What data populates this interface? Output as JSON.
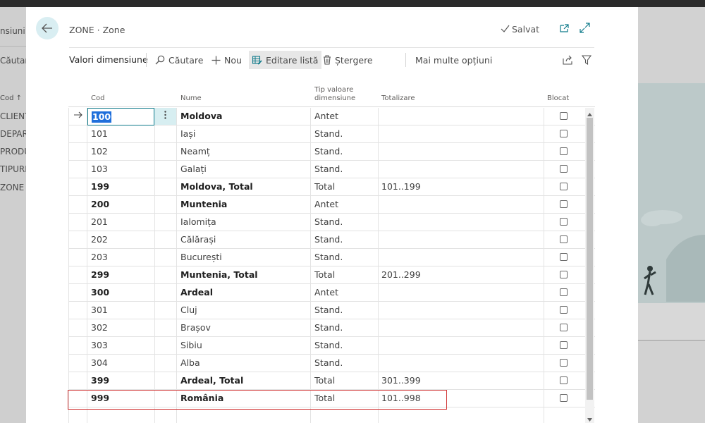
{
  "background": {
    "left_items": [
      "nsiuni",
      "Căutare",
      "Cod ↑",
      "CLIENT",
      "DEPAR",
      "PRODU",
      "TIPURI",
      "ZONE"
    ]
  },
  "header": {
    "breadcrumb": "ZONE · Zone",
    "saved_label": "Salvat"
  },
  "toolbar": {
    "title": "Valori dimensiune",
    "search_label": "Căutare",
    "new_label": "Nou",
    "edit_list_label": "Editare listă",
    "delete_label": "Ștergere",
    "more_label": "Mai multe opțiuni"
  },
  "table": {
    "columns": {
      "code": "Cod",
      "name": "Nume",
      "type_line1": "Tip valoare",
      "type_line2": "dimensiune",
      "totaling": "Totalizare",
      "blocked": "Blocat"
    },
    "rows": [
      {
        "code": "100",
        "name": "Moldova",
        "type": "Antet",
        "totaling": "",
        "bold": true,
        "selected": true
      },
      {
        "code": "101",
        "name": "Iași",
        "type": "Stand.",
        "totaling": "",
        "bold": false
      },
      {
        "code": "102",
        "name": "Neamț",
        "type": "Stand.",
        "totaling": "",
        "bold": false
      },
      {
        "code": "103",
        "name": "Galați",
        "type": "Stand.",
        "totaling": "",
        "bold": false
      },
      {
        "code": "199",
        "name": "Moldova, Total",
        "type": "Total",
        "totaling": "101..199",
        "bold": true
      },
      {
        "code": "200",
        "name": "Muntenia",
        "type": "Antet",
        "totaling": "",
        "bold": true
      },
      {
        "code": "201",
        "name": "Ialomița",
        "type": "Stand.",
        "totaling": "",
        "bold": false
      },
      {
        "code": "202",
        "name": "Călărași",
        "type": "Stand.",
        "totaling": "",
        "bold": false
      },
      {
        "code": "203",
        "name": "București",
        "type": "Stand.",
        "totaling": "",
        "bold": false
      },
      {
        "code": "299",
        "name": "Muntenia, Total",
        "type": "Total",
        "totaling": "201..299",
        "bold": true
      },
      {
        "code": "300",
        "name": "Ardeal",
        "type": "Antet",
        "totaling": "",
        "bold": true
      },
      {
        "code": "301",
        "name": "Cluj",
        "type": "Stand.",
        "totaling": "",
        "bold": false
      },
      {
        "code": "302",
        "name": "Brașov",
        "type": "Stand.",
        "totaling": "",
        "bold": false
      },
      {
        "code": "303",
        "name": "Sibiu",
        "type": "Stand.",
        "totaling": "",
        "bold": false
      },
      {
        "code": "304",
        "name": "Alba",
        "type": "Stand.",
        "totaling": "",
        "bold": false
      },
      {
        "code": "399",
        "name": "Ardeal, Total",
        "type": "Total",
        "totaling": "301..399",
        "bold": true
      },
      {
        "code": "999",
        "name": "România",
        "type": "Total",
        "totaling": "101..998",
        "bold": true
      }
    ]
  },
  "icons": {
    "back": "arrow-left-icon",
    "saved": "checkmark-icon",
    "open_new": "open-in-new-window-icon",
    "expand": "expand-icon",
    "search": "search-icon",
    "new": "plus-icon",
    "edit_list": "edit-list-icon",
    "delete": "trash-icon",
    "share": "share-icon",
    "filter": "filter-icon"
  },
  "colors": {
    "accent": "#0e7a8a",
    "highlight_border": "#d23a3a",
    "selection": "#1f6fdb"
  }
}
